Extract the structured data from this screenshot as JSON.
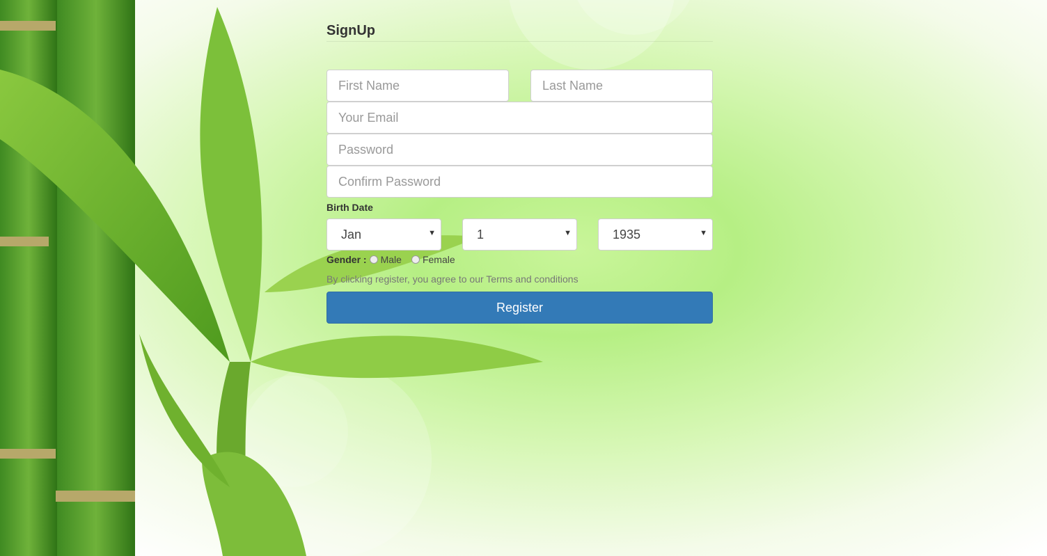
{
  "form": {
    "title": "SignUp",
    "fields": {
      "first_name": "First Name",
      "last_name": "Last Name",
      "email": "Your Email",
      "password": "Password",
      "confirm_password": "Confirm Password"
    },
    "birth_date": {
      "label": "Birth Date",
      "month": "Jan",
      "day": "1",
      "year": "1935"
    },
    "gender": {
      "label": "Gender :",
      "options": [
        "Male",
        "Female"
      ]
    },
    "terms": "By clicking register, you agree to our Terms and conditions",
    "submit_label": "Register"
  },
  "colors": {
    "button": "#337ab7",
    "background": "#b6ef84"
  }
}
